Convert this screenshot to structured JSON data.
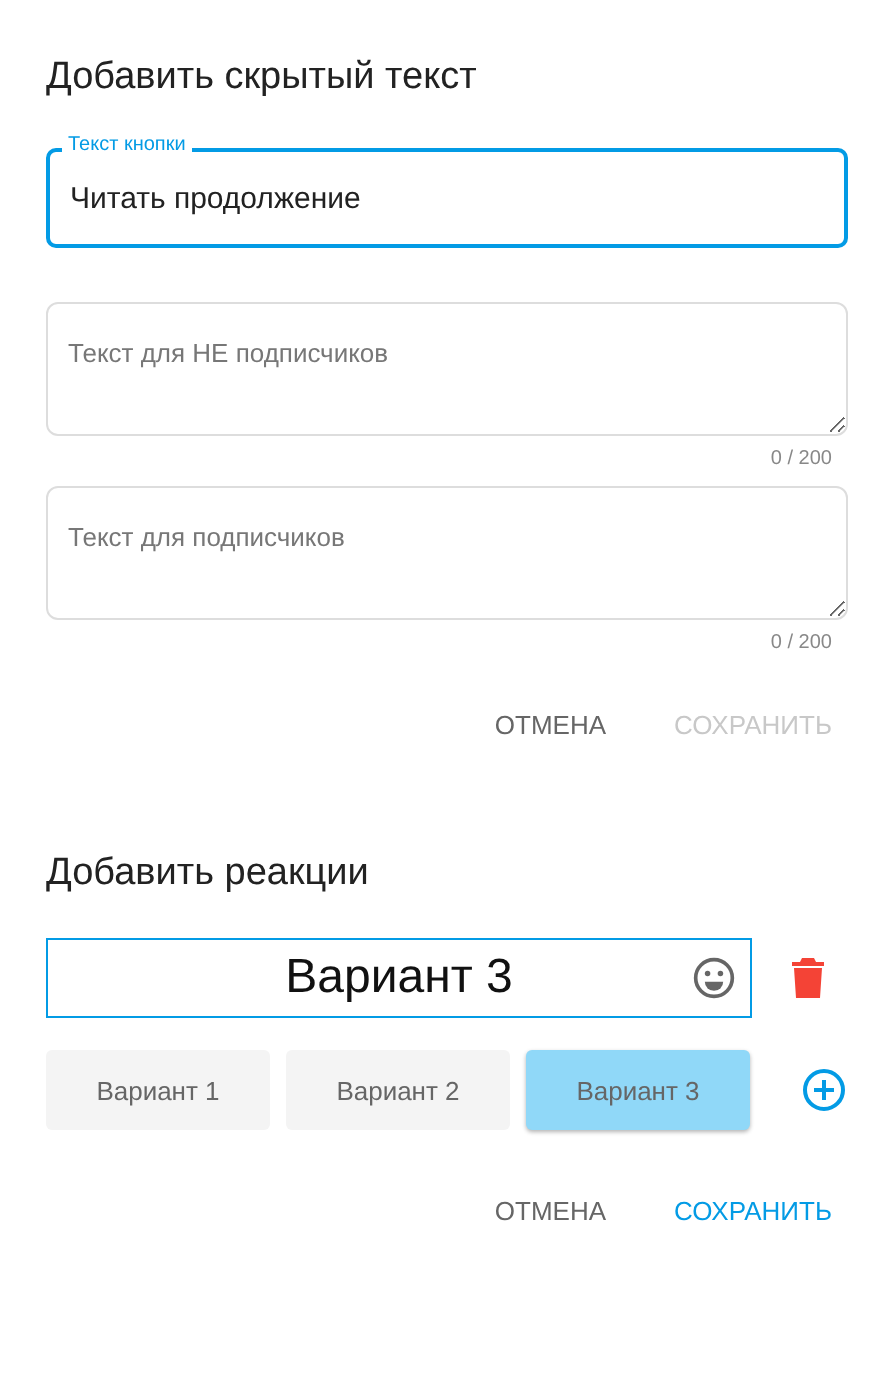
{
  "hidden_text": {
    "title": "Добавить скрытый текст",
    "button_field": {
      "label": "Текст кнопки",
      "value": "Читать продолжение",
      "focused": true
    },
    "textareas": [
      {
        "placeholder": "Текст для НЕ подписчиков",
        "counter": "0 / 200"
      },
      {
        "placeholder": "Текст для подписчиков",
        "counter": "0 / 200"
      }
    ],
    "actions": [
      {
        "label": "ОТМЕНА",
        "kind": "cancel",
        "disabled": false
      },
      {
        "label": "СОХРАНИТЬ",
        "kind": "confirm",
        "disabled": true
      }
    ]
  },
  "reactions": {
    "title": "Добавить реакции",
    "input": {
      "value": "Вариант 3"
    },
    "options": [
      {
        "label": "Вариант 1",
        "selected": false
      },
      {
        "label": "Вариант 2",
        "selected": false
      },
      {
        "label": "Вариант 3",
        "selected": true
      }
    ],
    "actions": [
      {
        "label": "ОТМЕНА",
        "kind": "cancel",
        "disabled": false
      },
      {
        "label": "СОХРАНИТЬ",
        "kind": "confirm",
        "disabled": false
      }
    ]
  }
}
